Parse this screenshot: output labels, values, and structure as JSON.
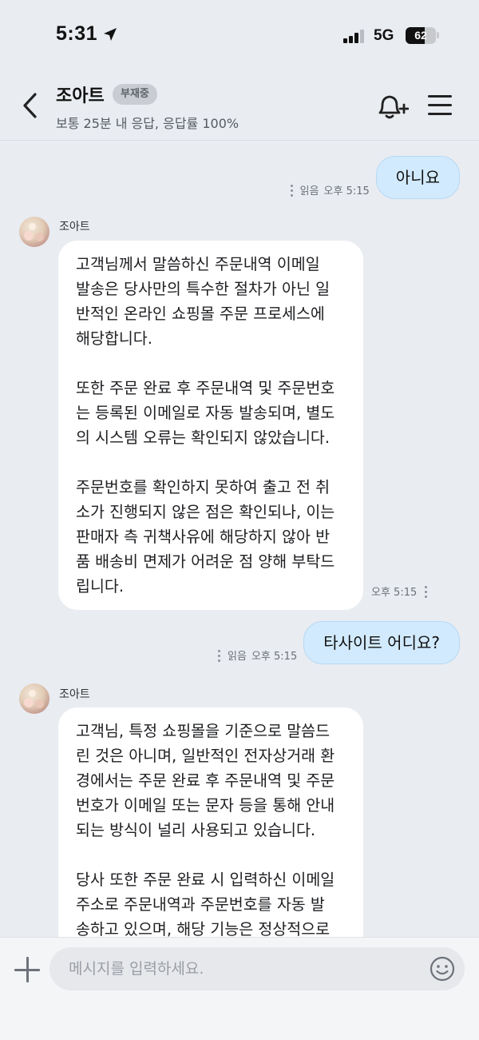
{
  "status_bar": {
    "time": "5:31",
    "network": "5G",
    "battery": "62",
    "battery_level": 0.62
  },
  "header": {
    "title": "조아트",
    "badge": "부재중",
    "subtitle": "보통 25분 내 응답, 응답률 100%",
    "icons": [
      "back-arrow-icon",
      "bell-plus-icon",
      "menu-icon"
    ]
  },
  "messages": [
    {
      "direction": "out",
      "text": "아니요",
      "read_label": "읽음",
      "time": "오후 5:15"
    },
    {
      "direction": "in",
      "sender": "조아트",
      "paragraphs": [
        [
          "고객님께서 말씀하신 주문내역 이메일",
          "발송은 당사만의 특수한 절차가 아닌 일",
          "반적인 온라인 쇼핑몰 주문 프로세스에",
          "해당합니다."
        ],
        [
          "또한 주문 완료 후 주문내역 및 주문번호",
          "는 등록된 이메일로 자동 발송되며, 별도",
          "의 시스템 오류는 확인되지 않았습니다."
        ],
        [
          "주문번호를 확인하지 못하여 출고 전 취",
          "소가 진행되지 않은 점은 확인되나, 이는",
          "판매자 측 귀책사유에 해당하지 않아 반",
          "품 배송비 면제가 어려운 점 양해 부탁드",
          "립니다."
        ]
      ],
      "time": "오후 5:15"
    },
    {
      "direction": "out",
      "text": "타사이트 어디요?",
      "read_label": "읽음",
      "time": "오후 5:15"
    },
    {
      "direction": "in",
      "sender": "조아트",
      "paragraphs": [
        [
          "고객님, 특정 쇼핑몰을 기준으로 말씀드",
          "린 것은 아니며, 일반적인 전자상거래 환",
          "경에서는 주문 완료 후 주문내역 및 주문",
          "번호가 이메일 또는 문자 등을 통해 안내",
          "되는 방식이 널리 사용되고 있습니다."
        ],
        [
          "당사 또한 주문 완료 시 입력하신 이메일",
          "주소로 주문내역과 주문번호를 자동 발",
          "송하고 있으며, 해당 기능은 정상적으로"
        ]
      ]
    }
  ],
  "input": {
    "placeholder": "메시지를 입력하세요.",
    "value": "",
    "icons": [
      "plus-icon",
      "emoji-icon"
    ]
  }
}
